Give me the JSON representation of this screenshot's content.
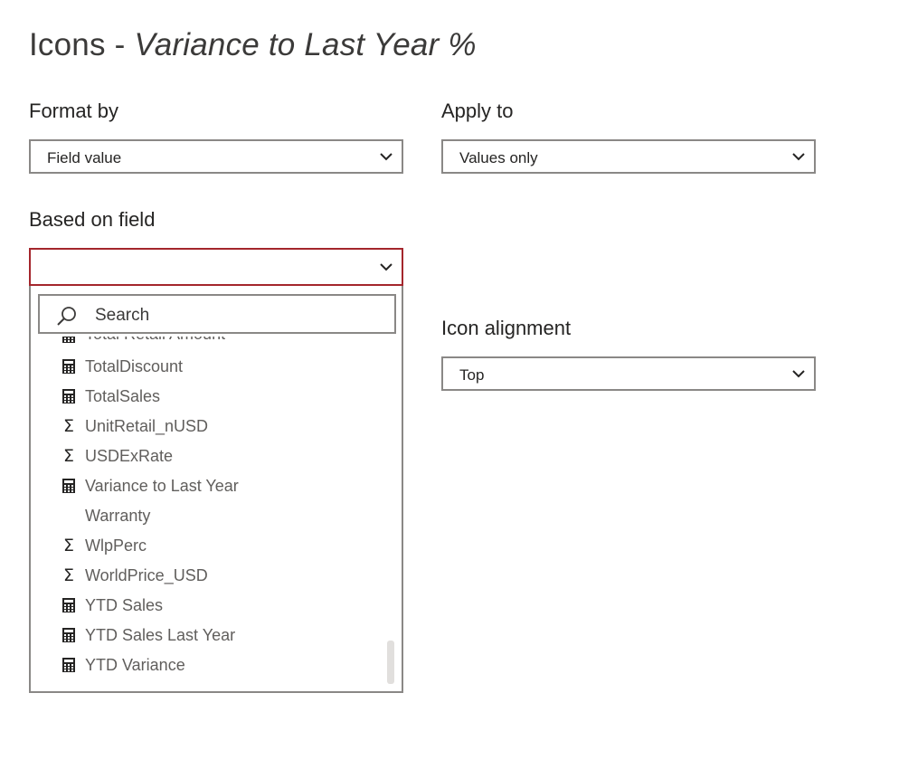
{
  "header": {
    "title_prefix": "Icons",
    "title_separator": "-",
    "title_measure": "Variance to Last Year %"
  },
  "format_by": {
    "label": "Format by",
    "value": "Field value"
  },
  "apply_to": {
    "label": "Apply to",
    "value": "Values only"
  },
  "based_on_field": {
    "label": "Based on field",
    "value": "",
    "search_placeholder": "Search",
    "items": [
      {
        "label": "Total Retail Amount",
        "icon": "calculator-icon"
      },
      {
        "label": "TotalDiscount",
        "icon": "calculator-icon"
      },
      {
        "label": "TotalSales",
        "icon": "calculator-icon"
      },
      {
        "label": "UnitRetail_nUSD",
        "icon": "sigma-icon"
      },
      {
        "label": "USDExRate",
        "icon": "sigma-icon"
      },
      {
        "label": "Variance to Last Year",
        "icon": "calculator-icon"
      },
      {
        "label": "Warranty",
        "icon": "none"
      },
      {
        "label": "WlpPerc",
        "icon": "sigma-icon"
      },
      {
        "label": "WorldPrice_USD",
        "icon": "sigma-icon"
      },
      {
        "label": "YTD Sales",
        "icon": "calculator-icon"
      },
      {
        "label": "YTD Sales Last Year",
        "icon": "calculator-icon"
      },
      {
        "label": "YTD Variance",
        "icon": "calculator-icon"
      }
    ]
  },
  "icon_alignment": {
    "label": "Icon alignment",
    "value": "Top"
  },
  "colors": {
    "border": "#8a8886",
    "active_border": "#a4262c",
    "text": "#252423",
    "muted_text": "#605e5c"
  }
}
